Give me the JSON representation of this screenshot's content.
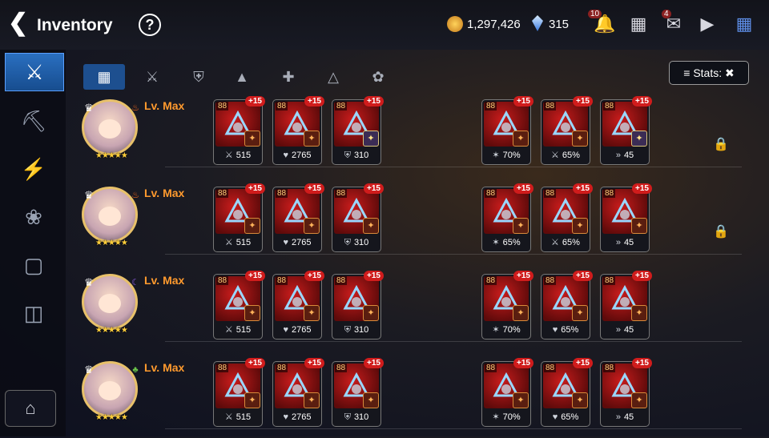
{
  "header": {
    "title": "Inventory",
    "gold": "1,297,426",
    "crystals": "315",
    "notification_badge": "10",
    "mail_badge": "4"
  },
  "tabs": [
    "all",
    "weapon",
    "armor",
    "helmet",
    "bow",
    "hat",
    "boots"
  ],
  "stats_button": "Stats:",
  "heroes": [
    {
      "level": "Lv. Max",
      "stars": "★★★★★",
      "element": "fire",
      "locked": true,
      "items": [
        {
          "ilvl": "88",
          "plus": "+15",
          "stat": "515",
          "stat_icon": "attack",
          "set": "orange"
        },
        {
          "ilvl": "88",
          "plus": "+15",
          "stat": "2765",
          "stat_icon": "health",
          "set": "orange"
        },
        {
          "ilvl": "88",
          "plus": "+15",
          "stat": "310",
          "stat_icon": "defense",
          "set": "gold"
        },
        {
          "ilvl": "88",
          "plus": "+15",
          "stat": "70%",
          "stat_icon": "crit",
          "set": "orange"
        },
        {
          "ilvl": "88",
          "plus": "+15",
          "stat": "65%",
          "stat_icon": "attack",
          "set": "orange"
        },
        {
          "ilvl": "88",
          "plus": "+15",
          "stat": "45",
          "stat_icon": "speed",
          "set": "gold"
        }
      ]
    },
    {
      "level": "Lv. Max",
      "stars": "★★★★★",
      "element": "fire",
      "locked": true,
      "items": [
        {
          "ilvl": "88",
          "plus": "+15",
          "stat": "515",
          "stat_icon": "attack",
          "set": "orange"
        },
        {
          "ilvl": "88",
          "plus": "+15",
          "stat": "2765",
          "stat_icon": "health",
          "set": "orange"
        },
        {
          "ilvl": "88",
          "plus": "+15",
          "stat": "310",
          "stat_icon": "defense",
          "set": "orange"
        },
        {
          "ilvl": "88",
          "plus": "+15",
          "stat": "65%",
          "stat_icon": "crit",
          "set": "orange"
        },
        {
          "ilvl": "88",
          "plus": "+15",
          "stat": "65%",
          "stat_icon": "attack",
          "set": "orange"
        },
        {
          "ilvl": "88",
          "plus": "+15",
          "stat": "45",
          "stat_icon": "speed",
          "set": "orange"
        }
      ]
    },
    {
      "level": "Lv. Max",
      "stars": "★★★★★",
      "element": "dark",
      "locked": false,
      "items": [
        {
          "ilvl": "88",
          "plus": "+15",
          "stat": "515",
          "stat_icon": "attack",
          "set": "orange"
        },
        {
          "ilvl": "88",
          "plus": "+15",
          "stat": "2765",
          "stat_icon": "health",
          "set": "orange"
        },
        {
          "ilvl": "88",
          "plus": "+15",
          "stat": "310",
          "stat_icon": "defense",
          "set": "orange"
        },
        {
          "ilvl": "88",
          "plus": "+15",
          "stat": "70%",
          "stat_icon": "crit",
          "set": "orange"
        },
        {
          "ilvl": "88",
          "plus": "+15",
          "stat": "65%",
          "stat_icon": "health",
          "set": "orange"
        },
        {
          "ilvl": "88",
          "plus": "+15",
          "stat": "45",
          "stat_icon": "speed",
          "set": "orange"
        }
      ]
    },
    {
      "level": "Lv. Max",
      "stars": "★★★★★",
      "element": "earth",
      "locked": false,
      "items": [
        {
          "ilvl": "88",
          "plus": "+15",
          "stat": "515",
          "stat_icon": "attack",
          "set": "orange"
        },
        {
          "ilvl": "88",
          "plus": "+15",
          "stat": "2765",
          "stat_icon": "health",
          "set": "orange"
        },
        {
          "ilvl": "88",
          "plus": "+15",
          "stat": "310",
          "stat_icon": "defense",
          "set": "orange"
        },
        {
          "ilvl": "88",
          "plus": "+15",
          "stat": "70%",
          "stat_icon": "crit",
          "set": "orange"
        },
        {
          "ilvl": "88",
          "plus": "+15",
          "stat": "65%",
          "stat_icon": "health",
          "set": "orange"
        },
        {
          "ilvl": "88",
          "plus": "+15",
          "stat": "45",
          "stat_icon": "speed",
          "set": "orange"
        }
      ]
    }
  ],
  "colors": {
    "accent": "#1d4f8f",
    "level": "#ff9a2e",
    "item_bg": "#c81c1c",
    "badge": "#d01c1c"
  }
}
